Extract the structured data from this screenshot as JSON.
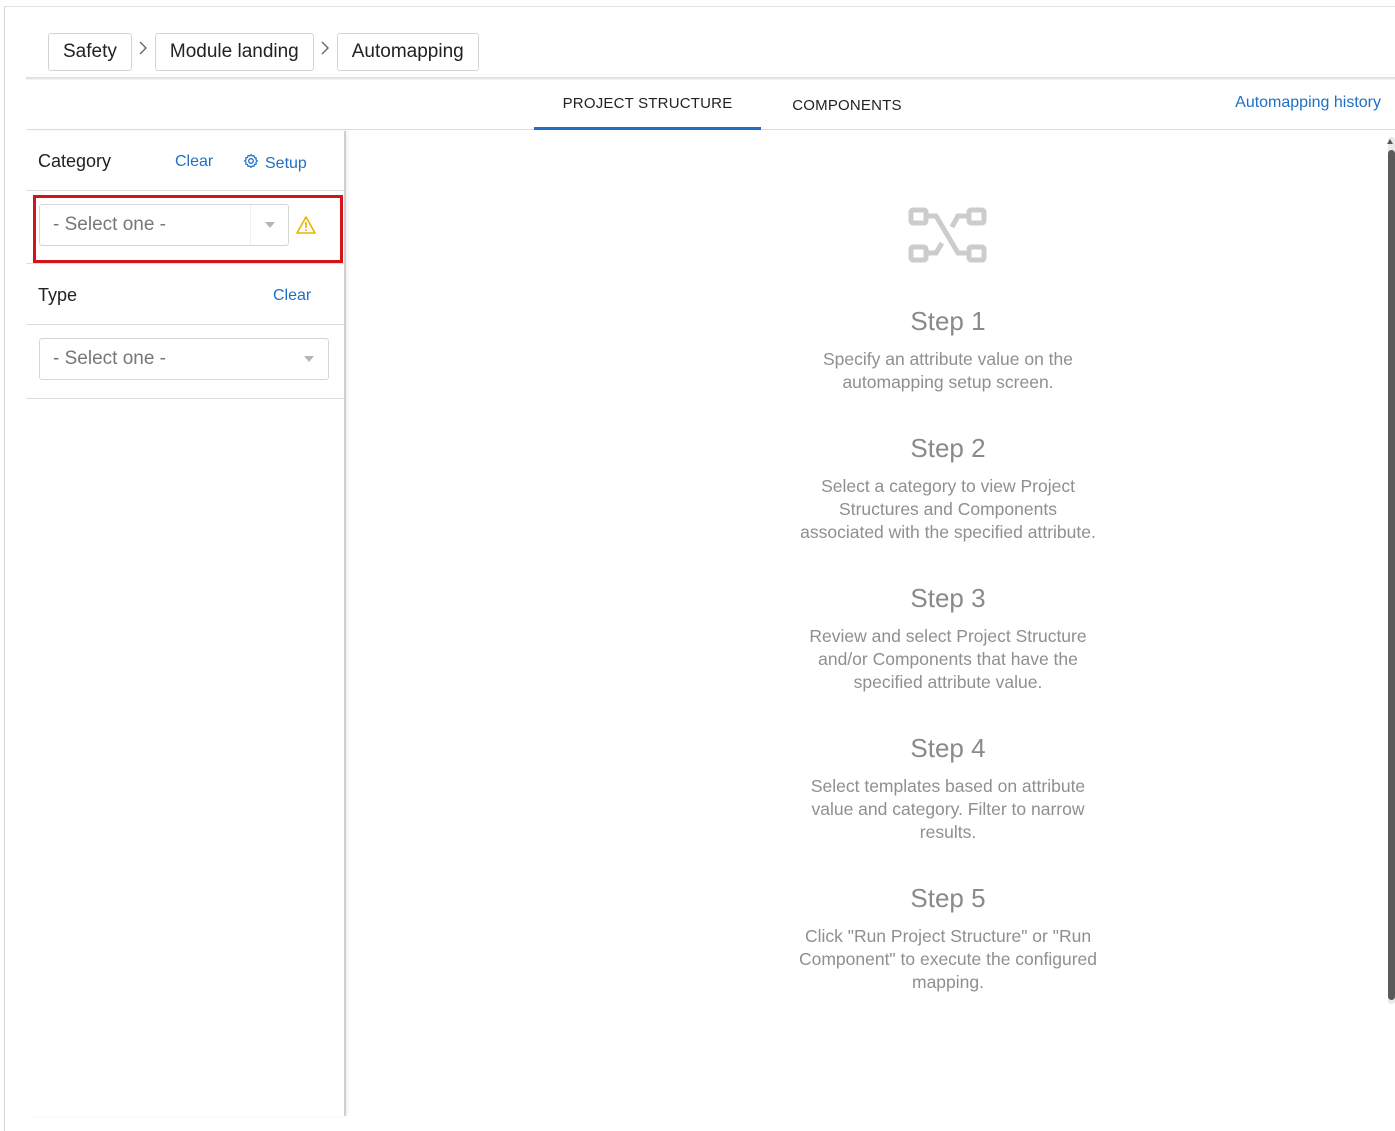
{
  "breadcrumb": {
    "items": [
      {
        "label": "Safety"
      },
      {
        "label": "Module landing"
      },
      {
        "label": "Automapping"
      }
    ]
  },
  "tabs": [
    {
      "label": "PROJECT STRUCTURE",
      "active": true
    },
    {
      "label": "COMPONENTS",
      "active": false
    }
  ],
  "history_link": "Automapping history",
  "sidebar": {
    "category": {
      "title": "Category",
      "clear_label": "Clear",
      "setup_label": "Setup",
      "select_placeholder": "- Select one -",
      "warning_icon": "warning-icon"
    },
    "type": {
      "title": "Type",
      "clear_label": "Clear",
      "select_placeholder": "- Select one -"
    }
  },
  "main": {
    "icon": "flow-mapping-icon",
    "steps": [
      {
        "title": "Step 1",
        "description": "Specify an attribute value on the automapping setup screen."
      },
      {
        "title": "Step 2",
        "description": "Select a category to view Project Structures and Components associated with the specified attribute."
      },
      {
        "title": "Step 3",
        "description": "Review and select Project Structure and/or Components that have the specified attribute value."
      },
      {
        "title": "Step 4",
        "description": "Select templates based on attribute value and category. Filter to narrow results."
      },
      {
        "title": "Step 5",
        "description": "Click \"Run Project Structure\" or \"Run Component\" to execute the configured mapping."
      }
    ]
  },
  "colors": {
    "accent": "#1f6fc4",
    "highlight": "#d3141b",
    "warning": "#e8b400",
    "muted_text": "#8f8f8f"
  }
}
